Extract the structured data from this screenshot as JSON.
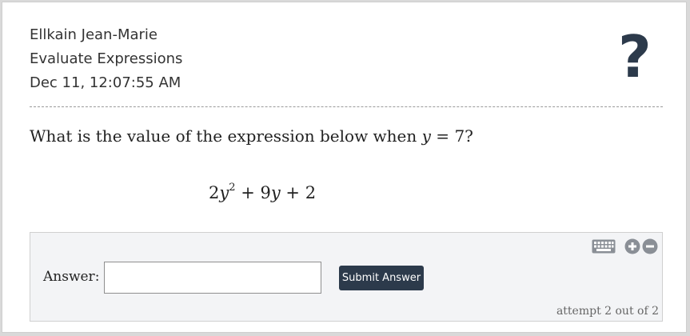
{
  "header": {
    "student_name": "Ellkain Jean-Marie",
    "assignment": "Evaluate Expressions",
    "timestamp": "Dec 11, 12:07:55 AM",
    "help_glyph": "?"
  },
  "question": {
    "prefix": "What is the value of the expression below when ",
    "variable": "y",
    "equals": " = ",
    "value": "7",
    "suffix": "?"
  },
  "expression": {
    "coef1": "2",
    "var1": "y",
    "exponent": "2",
    "op1": " + ",
    "coef2": "9",
    "var2": "y",
    "op2": " + ",
    "constant": "2"
  },
  "answer": {
    "label": "Answer:",
    "value": "",
    "submit_label": "Submit Answer",
    "attempt_text": "attempt 2 out of 2"
  },
  "colors": {
    "accent": "#2c3a4b",
    "panel_bg": "#f3f4f6",
    "icon_gray": "#8a8f96"
  },
  "icons": [
    "help-icon",
    "keyboard-icon",
    "zoom-in-icon",
    "zoom-out-icon"
  ]
}
